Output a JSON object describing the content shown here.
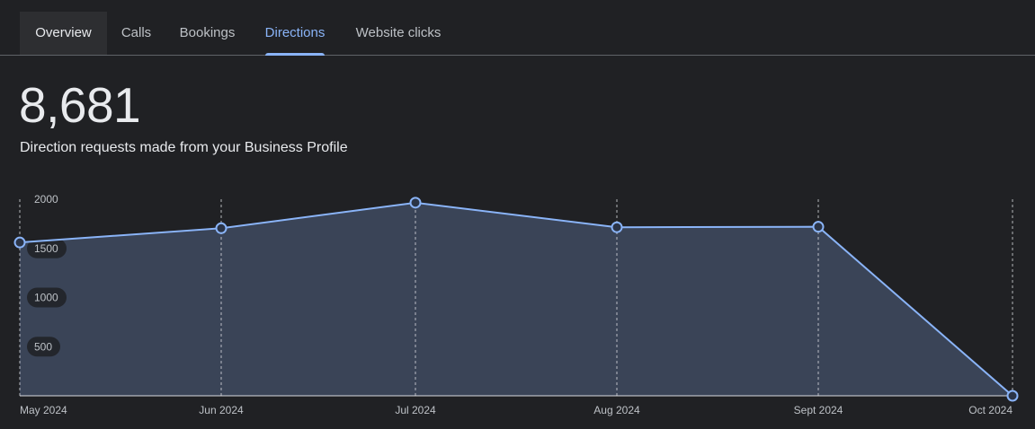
{
  "tabs": [
    {
      "label": "Overview"
    },
    {
      "label": "Calls"
    },
    {
      "label": "Bookings"
    },
    {
      "label": "Directions"
    },
    {
      "label": "Website clicks"
    }
  ],
  "selected_tab": "Directions",
  "summary": {
    "total": "8,681",
    "caption": "Direction requests made from your Business Profile"
  },
  "colors": {
    "line": "#8ab4f8",
    "area": "#3a4457",
    "accent": "#8ab4f8"
  },
  "chart_data": {
    "type": "area",
    "title": "",
    "xlabel": "",
    "ylabel": "",
    "categories": [
      "May 2024",
      "Jun 2024",
      "Jul 2024",
      "Aug 2024",
      "Sept 2024",
      "Oct 2024"
    ],
    "x_positions": [
      0,
      1,
      2,
      3,
      4,
      5.0
    ],
    "x_label_text": [
      "May 2024",
      "Jun 2024",
      "Jul 2024",
      "Aug 2024",
      "Sept 2024",
      "Oct 2024"
    ],
    "values": [
      1560,
      1705,
      1965,
      1715,
      1720,
      0
    ],
    "ylim": [
      0,
      2000
    ],
    "y_ticks": [
      500,
      1000,
      1500,
      2000
    ],
    "y_tick_labels": [
      "500",
      "1000",
      "1500",
      "2000"
    ],
    "grid": "vertical dashed",
    "legend": "none"
  }
}
